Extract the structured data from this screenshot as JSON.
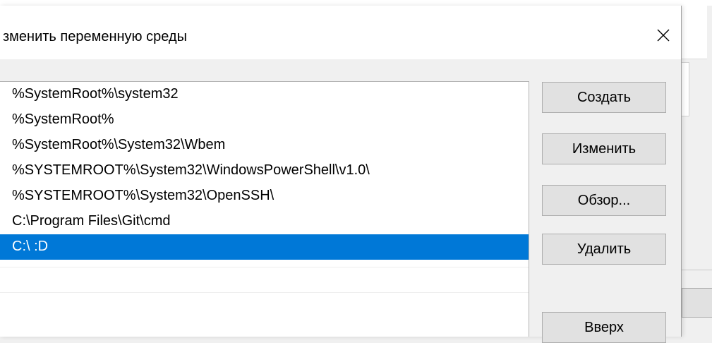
{
  "dialog": {
    "title": "зменить переменную среды",
    "close_glyph": "×"
  },
  "path_list": {
    "items": [
      "%SystemRoot%\\system32",
      "%SystemRoot%",
      "%SystemRoot%\\System32\\Wbem",
      "%SYSTEMROOT%\\System32\\WindowsPowerShell\\v1.0\\",
      "%SYSTEMROOT%\\System32\\OpenSSH\\",
      "C:\\Program Files\\Git\\cmd",
      "C:\\ :D"
    ],
    "selected_index": 6,
    "selection_color": "#0078d7"
  },
  "buttons": {
    "create": "Создать",
    "edit": "Изменить",
    "browse": "Обзор...",
    "delete": "Удалить",
    "up": "Вверх"
  },
  "icons": {
    "close": "close-icon"
  }
}
